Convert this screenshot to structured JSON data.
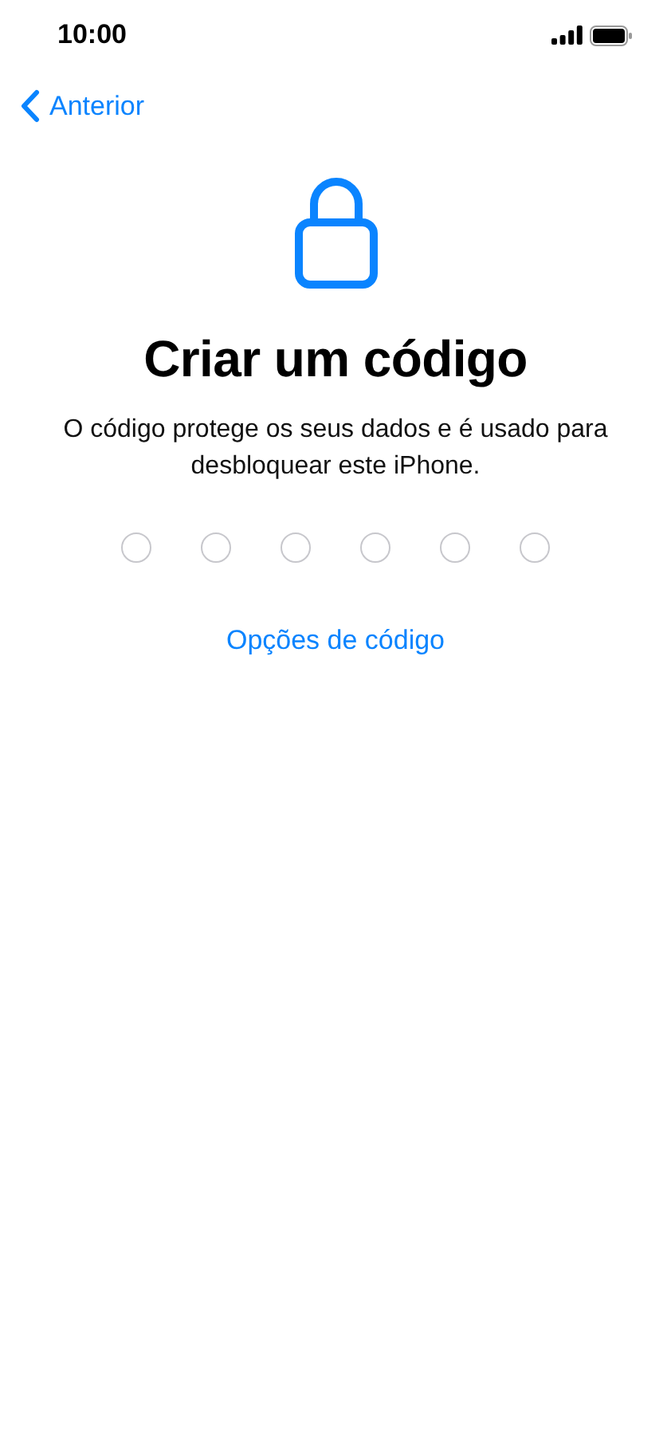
{
  "status_bar": {
    "time": "10:00"
  },
  "nav": {
    "back_label": "Anterior"
  },
  "title": "Criar um código",
  "description": "O código protege os seus dados e é usado para desbloquear este iPhone.",
  "passcode_dots": [
    {
      "filled": false
    },
    {
      "filled": false
    },
    {
      "filled": false
    },
    {
      "filled": false
    },
    {
      "filled": false
    },
    {
      "filled": false
    }
  ],
  "options_link": "Opções de código"
}
